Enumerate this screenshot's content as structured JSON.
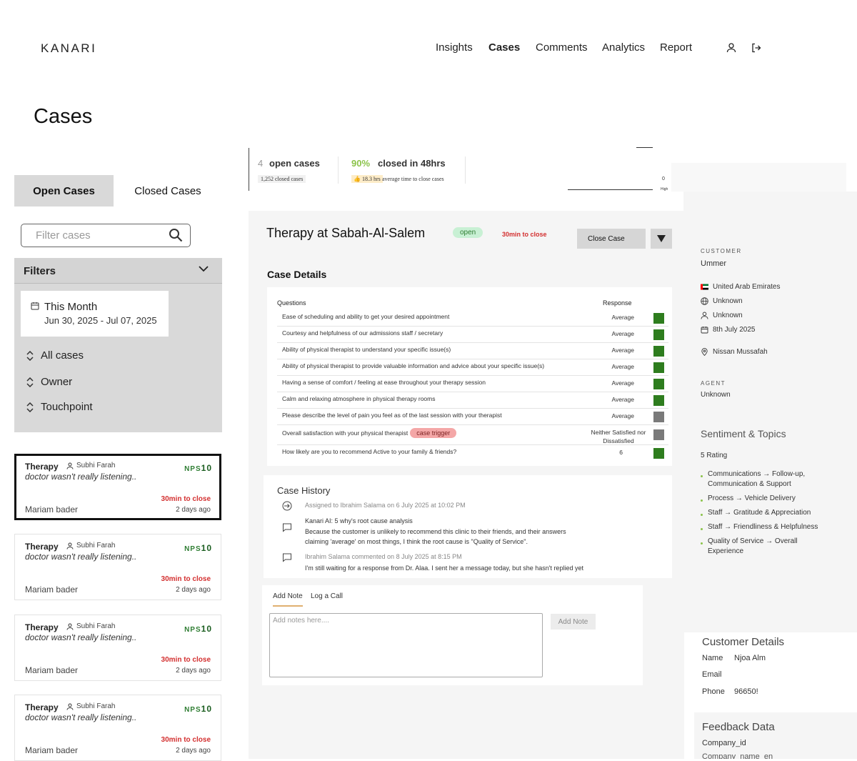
{
  "app": {
    "logo": "KANARI"
  },
  "nav": {
    "items": [
      {
        "label": "Insights",
        "active": false
      },
      {
        "label": "Cases",
        "active": true
      },
      {
        "label": "Comments",
        "active": false
      },
      {
        "label": "Analytics",
        "active": false
      },
      {
        "label": "Report",
        "active": false
      }
    ],
    "icons": [
      "user-icon",
      "logout-icon"
    ]
  },
  "page": {
    "title": "Cases"
  },
  "tabs": {
    "open": "Open Cases",
    "closed": "Closed Cases"
  },
  "search": {
    "placeholder": "Filter cases"
  },
  "filters": {
    "title": "Filters",
    "date_label": "This Month",
    "date_range": "Jun 30, 2025 - Jul 07, 2025",
    "options": [
      "All cases",
      "Owner",
      "Touchpoint"
    ]
  },
  "cards": [
    {
      "category": "Therapy",
      "owner": "Subhi Farah",
      "comment": "doctor wasn't really listening..",
      "nps_label": "NPS",
      "nps": "10",
      "time_to_close": "30min to close",
      "customer": "Mariam bader",
      "age": "2 days ago",
      "selected": true
    },
    {
      "category": "Therapy",
      "owner": "Subhi Farah",
      "comment": "doctor wasn't really listening..",
      "nps_label": "NPS",
      "nps": "10",
      "time_to_close": "30min to close",
      "customer": "Mariam bader",
      "age": "2 days ago",
      "selected": false
    },
    {
      "category": "Therapy",
      "owner": "Subhi Farah",
      "comment": "doctor wasn't really listening..",
      "nps_label": "NPS",
      "nps": "10",
      "time_to_close": "30min to close",
      "customer": "Mariam bader",
      "age": "2 days ago",
      "selected": false
    },
    {
      "category": "Therapy",
      "owner": "Subhi Farah",
      "comment": "doctor wasn't really listening..",
      "nps_label": "NPS",
      "nps": "10",
      "time_to_close": "30min to close",
      "customer": "Mariam bader",
      "age": "2 days ago",
      "selected": false
    }
  ],
  "stats": {
    "open_count": "4",
    "open_label": "open cases",
    "closed_sub": "1,252 closed cases",
    "pct": "90%",
    "pct_label": "closed in 48hrs",
    "avg_badge": "👍 18.3 hrs",
    "avg_label": "average time to close cases",
    "mini_zero": "0",
    "mini_high": "High"
  },
  "case": {
    "title": "Therapy at Sabah-Al-Salem",
    "status": "open",
    "time_to_close": "30min to close",
    "close_button": "Close Case",
    "details_title": "Case Details",
    "questions_header": "Questions",
    "response_header": "Response",
    "trigger_label": "case trigger",
    "questions": [
      {
        "q": "Ease of scheduling and ability to get your desired appointment",
        "r": "Average",
        "color": "#2e7d1e"
      },
      {
        "q": "Courtesy and helpfulness of our admissions staff / secretary",
        "r": "Average",
        "color": "#2e7d1e"
      },
      {
        "q": "Ability of physical therapist to understand your specific issue(s)",
        "r": "Average",
        "color": "#2e7d1e"
      },
      {
        "q": "Ability of physical therapist to provide valuable information and advice about your specific issue(s)",
        "r": "Average",
        "color": "#2e7d1e"
      },
      {
        "q": "Having a sense of comfort / feeling at ease throughout your therapy session",
        "r": "Average",
        "color": "#2e7d1e"
      },
      {
        "q": "Calm and relaxing atmosphere in physical therapy rooms",
        "r": "Average",
        "color": "#2e7d1e"
      },
      {
        "q": "Please describe the level of pain you feel as of the last session with your therapist",
        "r": "Average",
        "color": "#7a7a7a"
      },
      {
        "q": "Overall satisfaction with your physical therapist",
        "r": "Neither Satisfied nor Dissatisfied",
        "color": "#7a7a7a",
        "trigger": true
      },
      {
        "q": "How likely are you to recommend Active to your family & friends?",
        "r": "6",
        "color": "#2e7d1e"
      }
    ]
  },
  "history": {
    "title": "Case History",
    "assigned": "Assigned to Ibrahim Salama on 6 July 2025 at 10:02 PM",
    "ai_title": "Kanari AI: 5 why's root cause analysis",
    "ai_text_1": "Because the customer is unlikely to recommend this clinic to their friends, and their answers",
    "ai_text_2": "claiming 'average' on most things, I think the root cause is \"Quality of Service\".",
    "comment_meta_name": "Ibrahim Salama",
    "comment_meta_rest": " commented on 8 July 2025 at 8:15 PM",
    "comment_text": "I'm still waiting for a response from Dr. Alaa. I sent her a message today, but she hasn't replied yet"
  },
  "notes": {
    "tab_add": "Add Note",
    "tab_call": "Log a Call",
    "placeholder": "Add notes here....",
    "button": "Add Note"
  },
  "customer": {
    "label": "CUSTOMER",
    "name": "Ummer",
    "country": "United Arab Emirates",
    "language": "Unknown",
    "gender": "Unknown",
    "date": "8th July 2025",
    "location": "Nissan Mussafah",
    "agent_label": "AGENT",
    "agent": "Unknown"
  },
  "sentiment": {
    "title": "Sentiment & Topics",
    "rating": "5  Rating",
    "topics": [
      [
        "Communications → Follow-up,",
        "Communication & Support"
      ],
      [
        "Process → Vehicle Delivery"
      ],
      [
        "Staff → Gratitude & Appreciation"
      ],
      [
        "Staff → Friendliness & Helpfulness"
      ],
      [
        "Quality of Service → Overall",
        "Experience"
      ]
    ]
  },
  "customer_details": {
    "title": "Customer Details",
    "name_label": "Name",
    "name_value": "Njoa Alm",
    "email_label": "Email",
    "phone_label": "Phone",
    "phone_value": "96650!"
  },
  "feedback": {
    "title": "Feedback Data",
    "company_id": "Company_id",
    "company_name": "Company_name_en"
  },
  "colors": {
    "accent_green": "#8bc34a",
    "danger": "#d32f2f",
    "panel_grey": "#d9d9d9"
  }
}
